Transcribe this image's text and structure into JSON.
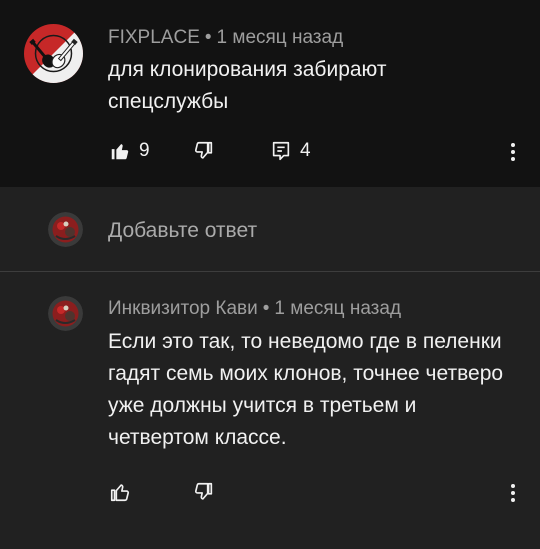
{
  "top_comment": {
    "author": "FIXPLACE",
    "separator": "•",
    "timestamp": "1 месяц назад",
    "text": "для клонирования забирают спецслужбы",
    "likes": "9",
    "replies": "4"
  },
  "reply_input": {
    "placeholder": "Добавьте ответ"
  },
  "reply_comment": {
    "author": "Инквизитор Кави",
    "separator": "•",
    "timestamp": "1 месяц назад",
    "text": "Если это так, то неведомо где в пеленки гадят семь моих клонов, точнее четверо уже должны учится в третьем и четвертом классе."
  },
  "icons": {
    "like": "thumbs-up-icon",
    "dislike": "thumbs-down-icon",
    "reply": "comment-icon",
    "menu": "more-vert-icon"
  },
  "colors": {
    "background": "#212121",
    "highlighted_background": "#121212",
    "text": "#f1f1f1",
    "meta_text": "#9e9e9e",
    "avatar_red": "#d32f2f"
  }
}
